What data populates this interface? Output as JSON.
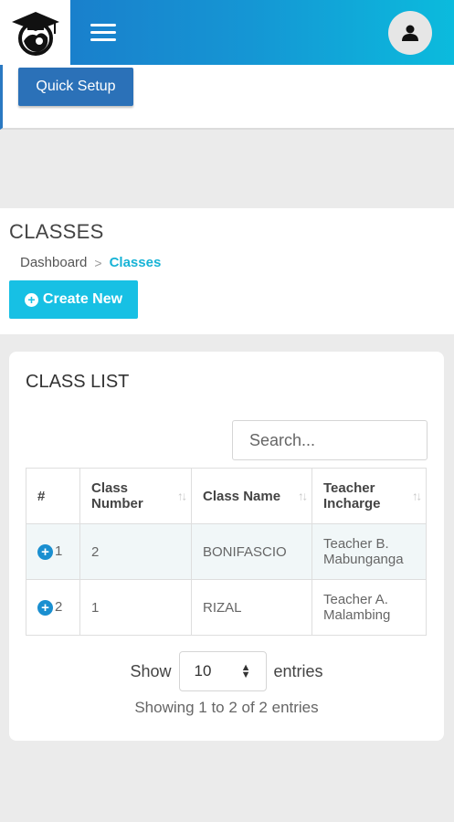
{
  "header": {
    "logo_icon": "graduation-cap-student-icon",
    "menu_icon": "hamburger-menu-icon",
    "avatar_icon": "user-icon"
  },
  "setup": {
    "quick_setup_label": "Quick Setup"
  },
  "page": {
    "title": "CLASSES",
    "breadcrumb": {
      "home": "Dashboard",
      "separator": ">",
      "current": "Classes"
    },
    "create_new_label": "Create New"
  },
  "class_list": {
    "title": "CLASS LIST",
    "search_placeholder": "Search...",
    "columns": [
      "#",
      "Class Number",
      "Class Name",
      "Teacher Incharge"
    ],
    "rows": [
      {
        "index": "1",
        "class_number": "2",
        "class_name": "BONIFASCIO",
        "teacher": "Teacher B. Mabunganga"
      },
      {
        "index": "2",
        "class_number": "1",
        "class_name": "RIZAL",
        "teacher": "Teacher A. Malambing"
      }
    ],
    "length": {
      "show": "Show",
      "value": "10",
      "entries": "entries"
    },
    "info": "Showing 1 to 2 of 2 entries"
  },
  "colors": {
    "header_start": "#1b77c9",
    "header_end": "#0bbbdd",
    "primary_button": "#2b71b8",
    "accent_button": "#17c0e4"
  }
}
